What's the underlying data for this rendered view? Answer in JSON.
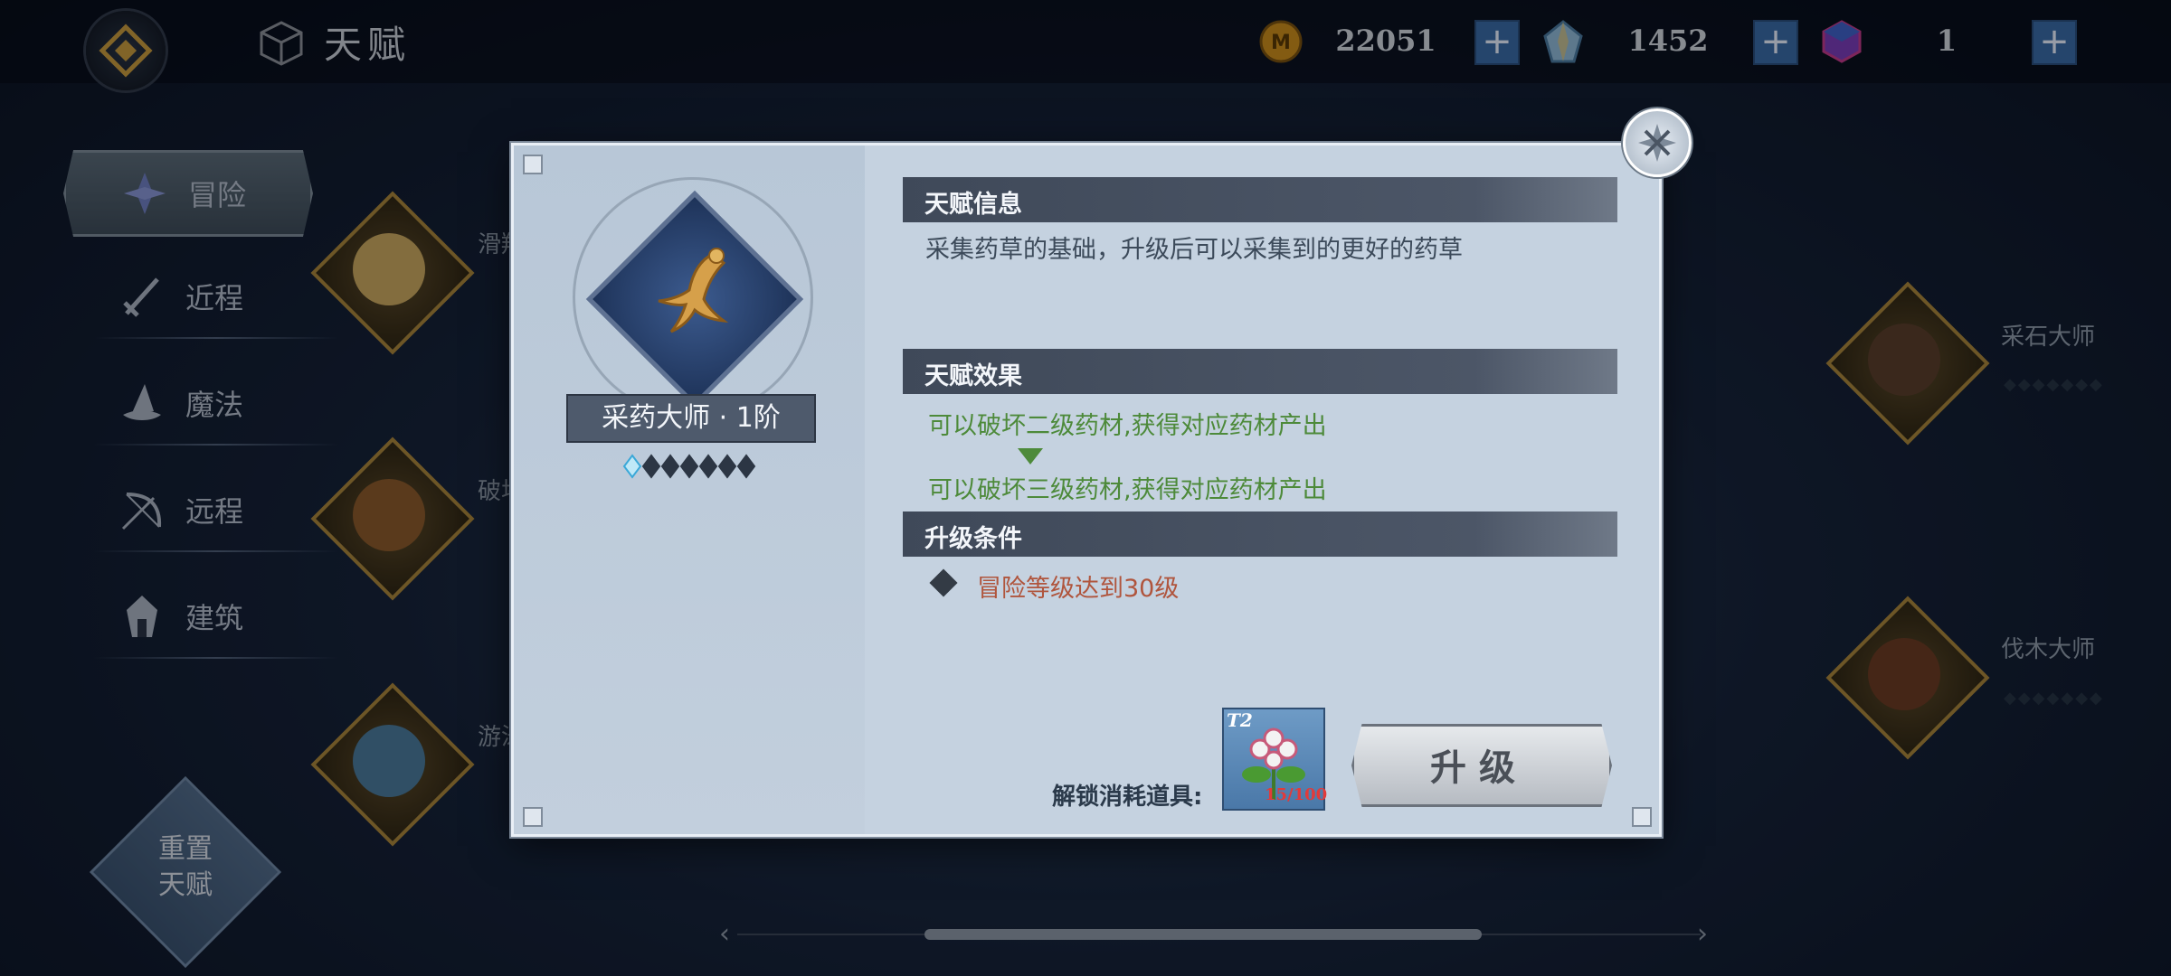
{
  "header": {
    "title": "天赋",
    "resources": [
      {
        "icon": "gold-coin-icon",
        "value": "22051"
      },
      {
        "icon": "crystal-icon",
        "value": "1452"
      },
      {
        "icon": "gem-cube-icon",
        "value": "1"
      }
    ],
    "plus_label": "+"
  },
  "sidebar": {
    "items": [
      {
        "label": "冒险",
        "icon": "adventure-icon",
        "active": true
      },
      {
        "label": "近程",
        "icon": "melee-icon",
        "active": false
      },
      {
        "label": "魔法",
        "icon": "magic-hat-icon",
        "active": false
      },
      {
        "label": "远程",
        "icon": "bow-icon",
        "active": false
      },
      {
        "label": "建筑",
        "icon": "building-icon",
        "active": false
      }
    ],
    "reset_label_1": "重置",
    "reset_label_2": "天赋"
  },
  "background_nodes": {
    "left": [
      {
        "label": "滑翔",
        "icon": "glider-icon"
      },
      {
        "label": "破坏",
        "icon": "tnt-barrel-icon"
      },
      {
        "label": "游泳",
        "icon": "swirl-icon"
      }
    ],
    "right": [
      {
        "label": "采石大师",
        "icon": "stone-block-icon"
      },
      {
        "label": "伐木大师",
        "icon": "log-icon"
      }
    ]
  },
  "dialog": {
    "talent_name": "采药大师 · 1阶",
    "rank": {
      "current": 1,
      "max": 7
    },
    "sections": {
      "info_title": "天赋信息",
      "info_text": "采集药草的基础，升级后可以采集到的更好的药草",
      "effect_title": "天赋效果",
      "effect_current": "可以破坏二级药材,获得对应药材产出",
      "effect_next": "可以破坏三级药材,获得对应药材产出",
      "condition_title": "升级条件",
      "condition_text": "冒险等级达到30级"
    },
    "cost_label": "解锁消耗道具:",
    "cost_item": {
      "tier": "T2",
      "count": "15/100",
      "icon": "herb-flower-icon"
    },
    "upgrade_label": "升级"
  },
  "colors": {
    "effect_green": "#4d8a3a",
    "condition_red": "#b0553d",
    "currency_plus_blue": "#3a6aa6"
  }
}
